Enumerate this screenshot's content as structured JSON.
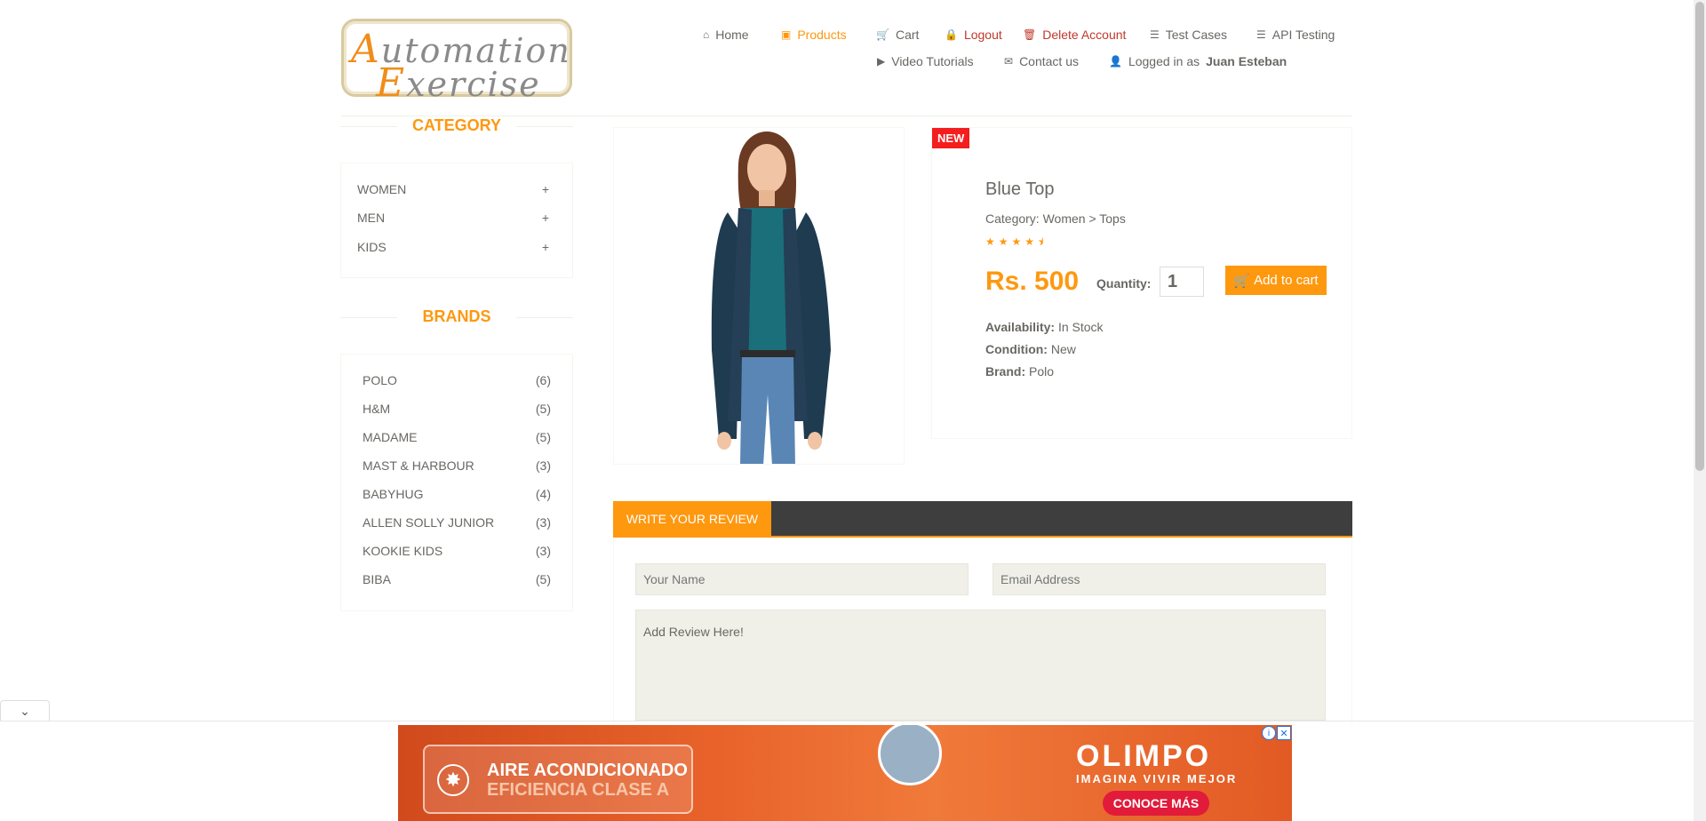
{
  "logo": {
    "line1_first": "A",
    "line1_rest": "utomation",
    "line2_first": "E",
    "line2_rest": "xercise"
  },
  "nav": {
    "home": "Home",
    "products": "Products",
    "cart": "Cart",
    "logout": "Logout",
    "delete_account": "Delete Account",
    "test_cases": "Test Cases",
    "api_testing": "API Testing",
    "video_tutorials": "Video Tutorials",
    "contact_us": "Contact us",
    "logged_in_prefix": "Logged in as",
    "user_name": "Juan Esteban"
  },
  "sidebar": {
    "category_title": "CATEGORY",
    "categories": [
      {
        "label": "WOMEN",
        "icon": "+"
      },
      {
        "label": "MEN",
        "icon": "+"
      },
      {
        "label": "KIDS",
        "icon": "+"
      }
    ],
    "brands_title": "BRANDS",
    "brands": [
      {
        "label": "POLO",
        "count": "(6)"
      },
      {
        "label": "H&M",
        "count": "(5)"
      },
      {
        "label": "MADAME",
        "count": "(5)"
      },
      {
        "label": "MAST & HARBOUR",
        "count": "(3)"
      },
      {
        "label": "BABYHUG",
        "count": "(4)"
      },
      {
        "label": "ALLEN SOLLY JUNIOR",
        "count": "(3)"
      },
      {
        "label": "KOOKIE KIDS",
        "count": "(3)"
      },
      {
        "label": "BIBA",
        "count": "(5)"
      }
    ]
  },
  "product": {
    "badge": "NEW",
    "name": "Blue Top",
    "category": "Category: Women > Tops",
    "rating": 4.5,
    "stars": "★★★★⯨",
    "price": "Rs. 500",
    "quantity_label": "Quantity:",
    "quantity_value": "1",
    "add_to_cart": "Add to cart",
    "availability_label": "Availability:",
    "availability_value": "In Stock",
    "condition_label": "Condition:",
    "condition_value": "New",
    "brand_label": "Brand:",
    "brand_value": "Polo"
  },
  "review": {
    "tab": "WRITE YOUR REVIEW",
    "name_placeholder": "Your Name",
    "email_placeholder": "Email Address",
    "review_placeholder": "Add Review Here!"
  },
  "ad": {
    "left_line1": "AIRE ACONDICIONADO",
    "left_line2": "EFICIENCIA CLASE A",
    "brand": "OLIMPO",
    "slogan": "IMAGINA VIVIR MEJOR",
    "button": "CONOCE MÁS",
    "info": "i",
    "close": "✕"
  },
  "colors": {
    "accent": "#fe980f",
    "badge": "#f51e1e",
    "dark_bar": "#3e3e3e",
    "text": "#696763",
    "red_link": "#c0392b"
  }
}
